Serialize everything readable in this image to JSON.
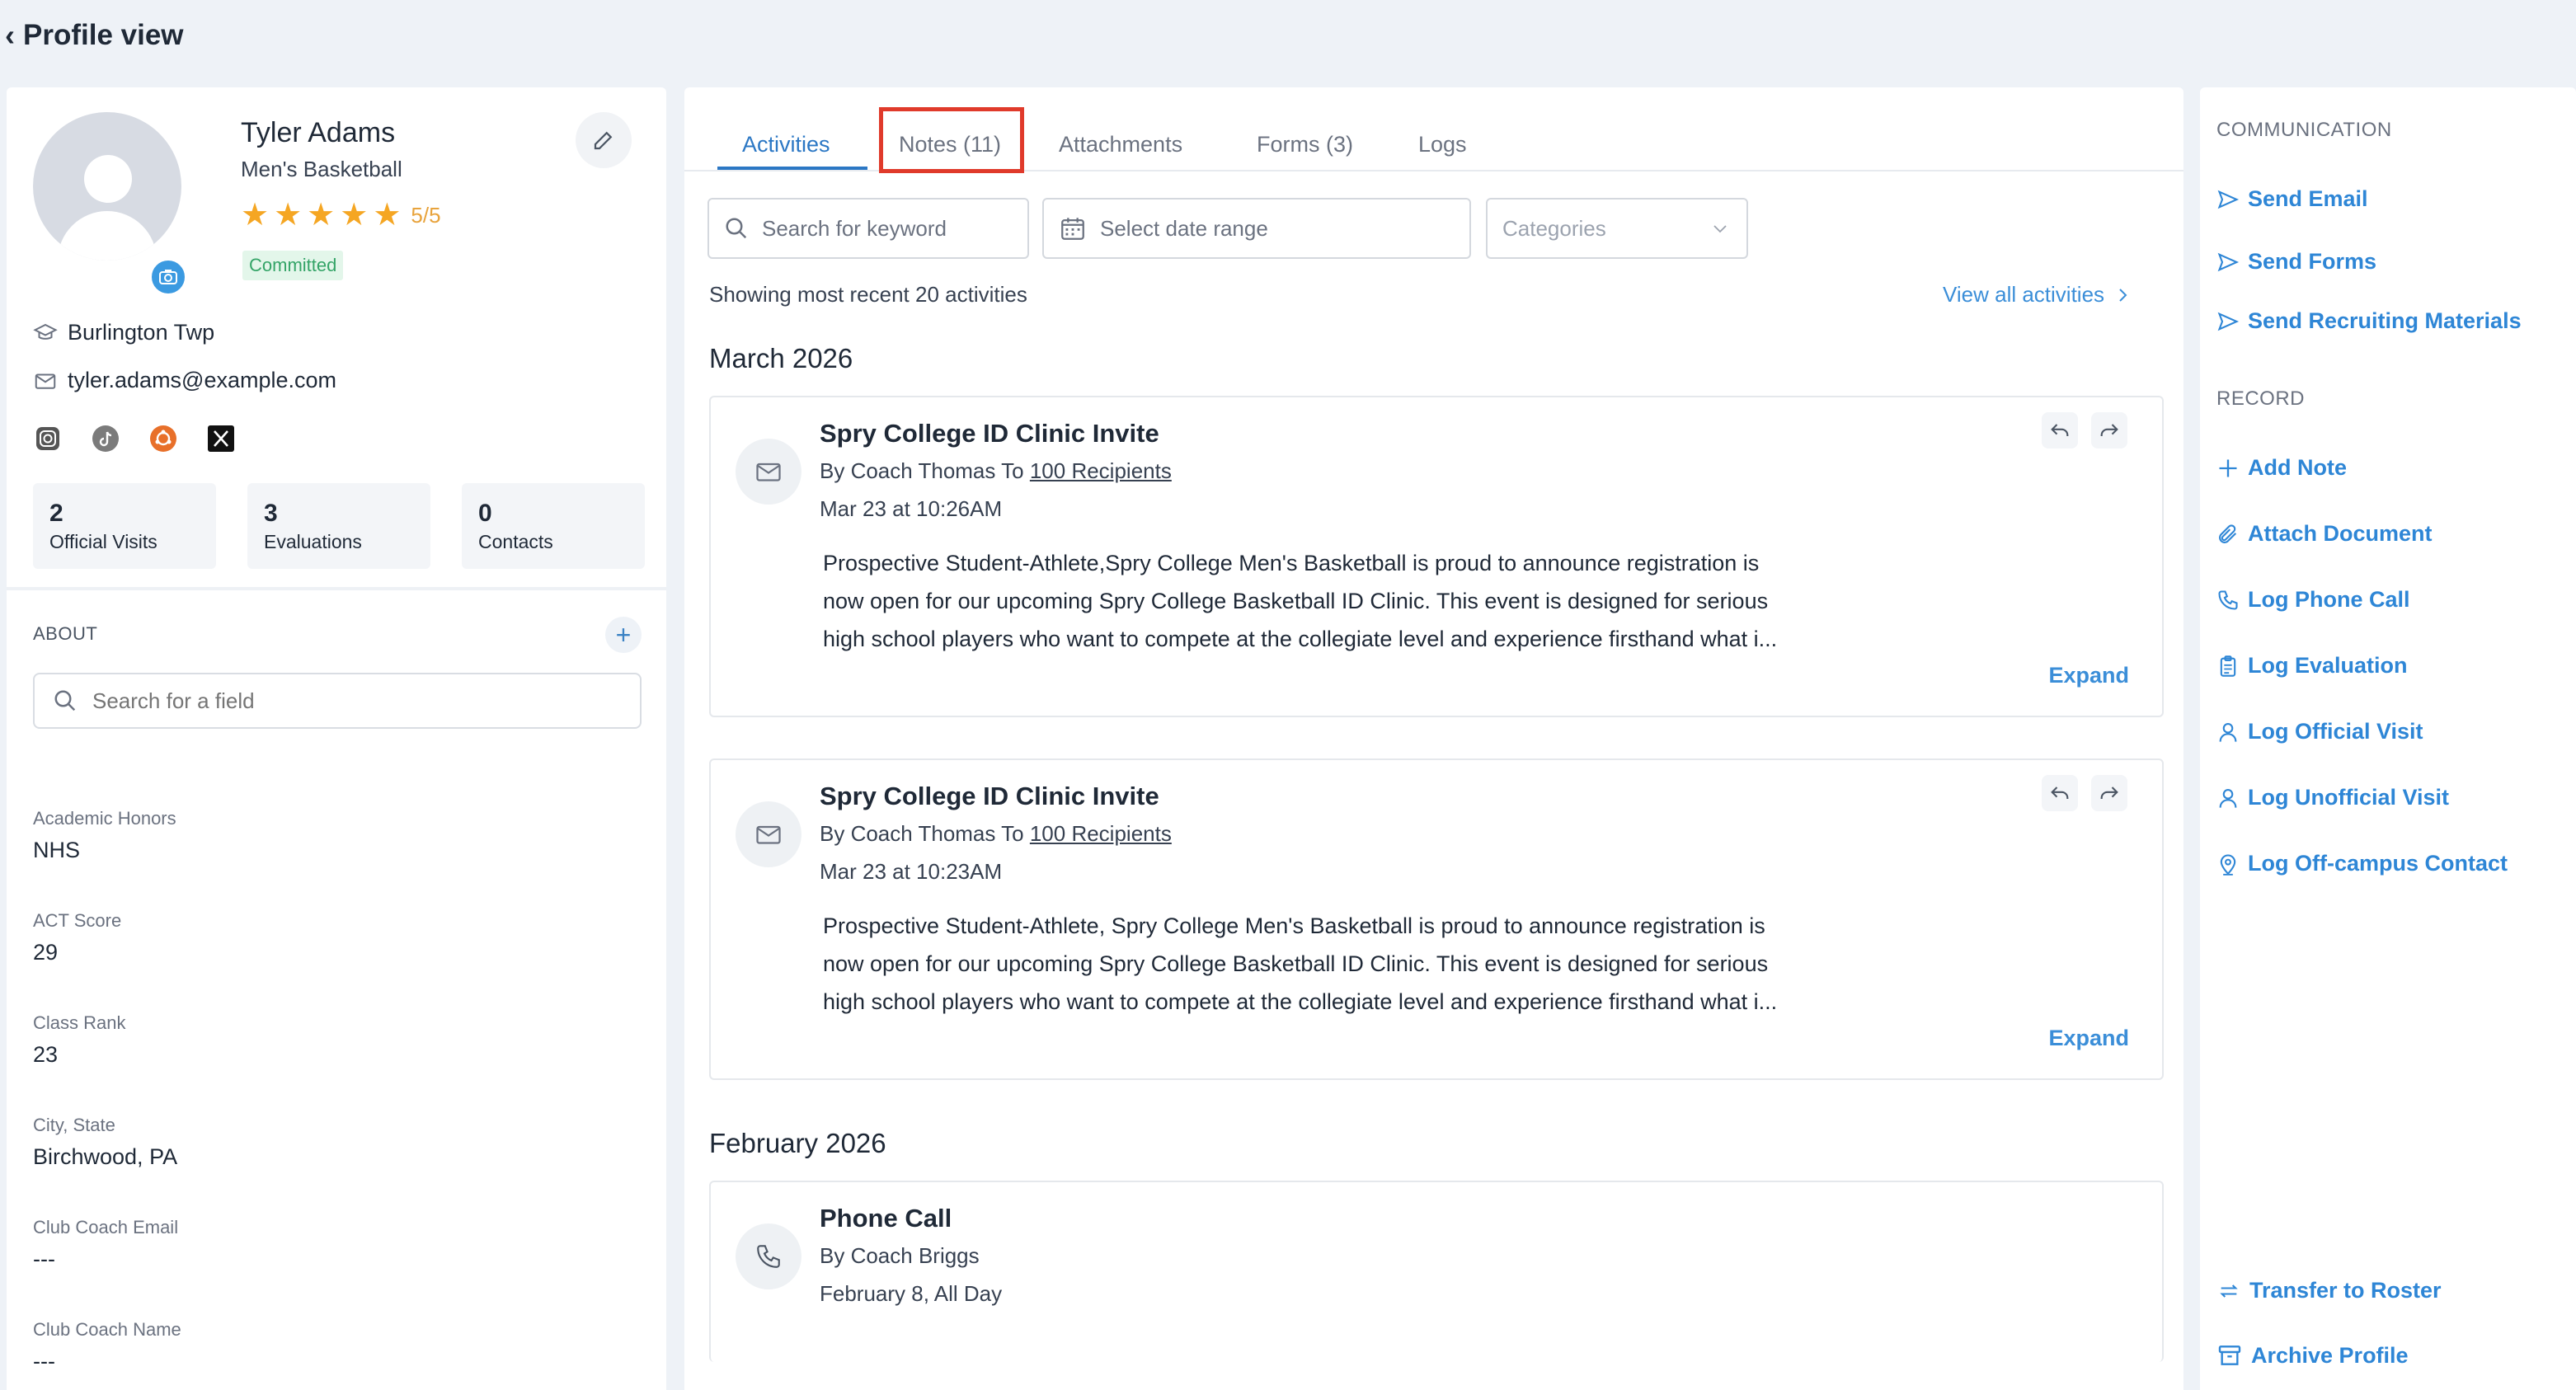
{
  "header": {
    "back_glyph": "‹",
    "title": "Profile view"
  },
  "profile": {
    "name": "Tyler Adams",
    "sport": "Men's Basketball",
    "rating": "5/5",
    "status": "Committed",
    "school": "Burlington Twp",
    "email": "tyler.adams@example.com",
    "socials": [
      "instagram-icon",
      "tiktok-icon",
      "link-icon",
      "x-icon"
    ],
    "stats": [
      {
        "num": "2",
        "label": "Official Visits"
      },
      {
        "num": "3",
        "label": "Evaluations"
      },
      {
        "num": "0",
        "label": "Contacts"
      }
    ]
  },
  "about": {
    "label": "ABOUT",
    "search_placeholder": "Search for a field",
    "fields": [
      {
        "label": "Academic Honors",
        "value": "NHS"
      },
      {
        "label": "ACT Score",
        "value": "29"
      },
      {
        "label": "Class Rank",
        "value": "23"
      },
      {
        "label": "City, State",
        "value": "Birchwood, PA"
      },
      {
        "label": "Club Coach Email",
        "value": "---"
      },
      {
        "label": "Club Coach Name",
        "value": "---"
      }
    ]
  },
  "tabs": [
    {
      "label": "Activities",
      "active": true
    },
    {
      "label": "Notes (11)",
      "active": false
    },
    {
      "label": "Attachments",
      "active": false
    },
    {
      "label": "Forms (3)",
      "active": false
    },
    {
      "label": "Logs",
      "active": false
    }
  ],
  "filters": {
    "keyword_placeholder": "Search for keyword",
    "date_label": "Select date range",
    "category_label": "Categories"
  },
  "activity": {
    "showing": "Showing most recent 20 activities",
    "view_all": "View all activities",
    "months": [
      "March 2026",
      "February 2026"
    ],
    "cards": [
      {
        "title": "Spry College ID Clinic Invite",
        "by": "By Coach Thomas To ",
        "recipients": "100 Recipients",
        "date": "Mar 23 at 10:26AM",
        "body": [
          "Prospective Student-Athlete,Spry College Men's Basketball is proud to announce registration is",
          "now open for our upcoming Spry College Basketball ID Clinic. This event is designed for serious",
          "high school players who want to compete at the collegiate level and experience firsthand what i..."
        ],
        "expand": "Expand"
      },
      {
        "title": "Spry College ID Clinic Invite",
        "by": "By Coach Thomas To ",
        "recipients": "100 Recipients",
        "date": "Mar 23 at 10:23AM",
        "body": [
          "Prospective Student-Athlete, Spry College Men's Basketball is proud to announce registration is",
          "now open for our upcoming Spry College Basketball ID Clinic. This event is designed for serious",
          "high school players who want to compete at the collegiate level and experience firsthand what i..."
        ],
        "expand": "Expand"
      },
      {
        "title": "Phone Call",
        "by": "By Coach Briggs",
        "date": "February 8, All Day"
      }
    ]
  },
  "sidebar": {
    "communication_label": "COMMUNICATION",
    "communication": [
      "Send Email",
      "Send Forms",
      "Send Recruiting Materials"
    ],
    "record_label": "RECORD",
    "record": [
      "Add Note",
      "Attach Document",
      "Log Phone Call",
      "Log Evaluation",
      "Log Official Visit",
      "Log Unofficial Visit",
      "Log Off-campus Contact"
    ],
    "bottom": [
      "Transfer to Roster",
      "Archive Profile"
    ]
  },
  "colors": {
    "accent": "#2e86d6",
    "star": "#f5a623",
    "highlight": "#e03a2b",
    "committed": "#34a467"
  }
}
